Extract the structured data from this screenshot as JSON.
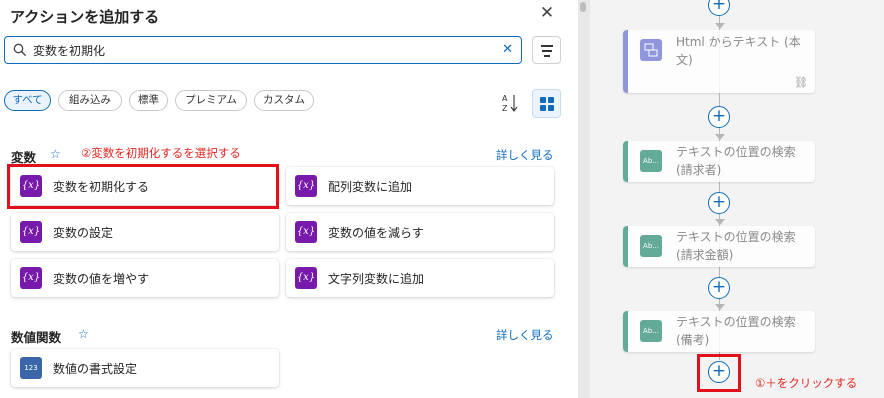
{
  "panel": {
    "title": "アクションを追加する",
    "close_icon": "close-icon"
  },
  "search": {
    "value": "変数を初期化",
    "icon": "search-icon",
    "clear_icon": "clear-icon"
  },
  "filters": {
    "chips": [
      "すべて",
      "組み込み",
      "標準",
      "プレミアム",
      "カスタム"
    ],
    "active": "すべて"
  },
  "sections": [
    {
      "title": "変数",
      "more": "詳しく見る",
      "annotation": "②変数を初期化するを選択する",
      "actions": [
        "変数を初期化する",
        "配列変数に追加",
        "変数の設定",
        "変数の値を減らす",
        "変数の値を増やす",
        "文字列変数に追加"
      ],
      "icon_glyph": "{x}"
    },
    {
      "title": "数値関数",
      "more": "詳しく見る",
      "actions": [
        "数値の書式設定"
      ],
      "icon_glyph": "123"
    }
  ],
  "flow": {
    "cards": [
      {
        "title": "Html からテキスト (本文)",
        "icon": "html-icon",
        "color": "#7f86d8"
      },
      {
        "title": "テキストの位置の検索(請求者)",
        "icon_text": "Ab...",
        "color": "#4a9e8a"
      },
      {
        "title": "テキストの位置の検索(請求金額)",
        "icon_text": "Ab...",
        "color": "#4a9e8a"
      },
      {
        "title": "テキストの位置の検索(備考)",
        "icon_text": "Ab...",
        "color": "#4a9e8a"
      }
    ],
    "annotation": "①＋をクリックする"
  },
  "colors": {
    "accent": "#0f6cbd",
    "highlight": "#e2101c",
    "variable_icon": "#7719aa"
  }
}
